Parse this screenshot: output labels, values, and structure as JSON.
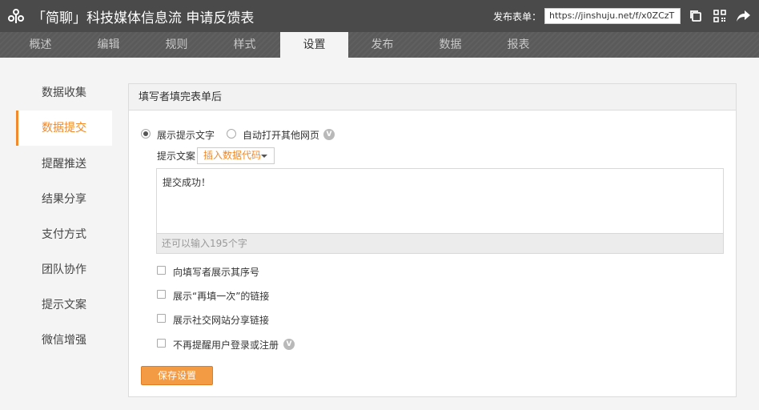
{
  "header": {
    "title": "「简聊」科技媒体信息流 申请反馈表",
    "publish_label": "发布表单：",
    "publish_url": "https://jinshuju.net/f/x0ZCzT"
  },
  "nav": {
    "tabs": [
      {
        "label": "概述"
      },
      {
        "label": "编辑"
      },
      {
        "label": "规则"
      },
      {
        "label": "样式"
      },
      {
        "label": "设置",
        "active": true
      },
      {
        "label": "发布"
      },
      {
        "label": "数据"
      },
      {
        "label": "报表"
      }
    ]
  },
  "sidebar": {
    "items": [
      {
        "label": "数据收集"
      },
      {
        "label": "数据提交",
        "active": true
      },
      {
        "label": "提醒推送"
      },
      {
        "label": "结果分享"
      },
      {
        "label": "支付方式"
      },
      {
        "label": "团队协作"
      },
      {
        "label": "提示文案"
      },
      {
        "label": "微信增强"
      }
    ]
  },
  "panel": {
    "title": "填写者填完表单后",
    "radio_show_text": "展示提示文字",
    "radio_open_page": "自动打开其他网页",
    "badge": "V",
    "tip_label": "提示文案",
    "insert_code": "插入数据代码",
    "message": "提交成功！",
    "remaining": "还可以输入195个字",
    "checkboxes": [
      {
        "label": "向填写者展示其序号"
      },
      {
        "label": "展示“再填一次”的链接"
      },
      {
        "label": "展示社交网站分享链接"
      },
      {
        "label": "不再提醒用户登录或注册"
      }
    ],
    "save": "保存设置"
  },
  "colors": {
    "accent": "#f08a2c",
    "topbar": "#4a4a4a",
    "navbar": "#5a5a5a"
  }
}
